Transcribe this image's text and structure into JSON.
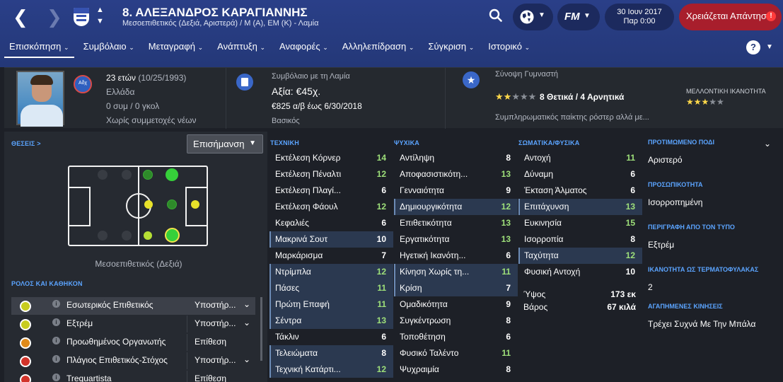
{
  "header": {
    "title": "8. ΑΛΕΞΑΝΔΡΟΣ ΚΑΡΑΓΙΑΝΝΗΣ",
    "subtitle": "Μεσοεπιθετικός (Δεξιά, Αριστερά) / Μ (Α), ΕΜ (Κ) - Λαμία",
    "date": "30 Ιουν 2017",
    "time": "Παρ 0:00",
    "alert": "Χρειάζεται Απάντηση",
    "fm_label": "FM",
    "help": "?",
    "colors": {
      "header": "#2a3f88",
      "alert": "#a81e2c",
      "accent": "#5ba4ff",
      "high_value": "#9ee07a"
    }
  },
  "menu": [
    "Επισκόπηση",
    "Συμβόλαιο",
    "Μεταγραφή",
    "Ανάπτυξη",
    "Αναφορές",
    "Αλληλεπίδραση",
    "Σύγκριση",
    "Ιστορικό"
  ],
  "info": {
    "age": "23 ετών",
    "dob": "(10/25/1993)",
    "nation": "Ελλάδα",
    "caps": "0 συμ / 0 γκολ",
    "youth": "Χωρίς συμμετοχές νέων",
    "club_badge": "Αδχ",
    "contract_title": "Συμβόλαιο με τη Λαμία",
    "value": "Αξία: €45χ.",
    "wage": "€825 α/β έως 6/30/2018",
    "status": "Βασικός",
    "coach_title": "Σύνοψη Γυμναστή",
    "coach_summary": "8 Θετικά / 4 Αρνητικά",
    "coach_comment": "Συμπληρωματικός παίκτης ρόστερ αλλά με...",
    "current_stars": 2.5,
    "potential_label": "ΜΕΛΛΟΝΤΙΚΗ ΙΚΑΝΟΤΗΤΑ",
    "potential_stars": 3.5
  },
  "positions": {
    "title": "ΘΕΣΕΙΣ >",
    "dropdown": "Επισήμανση",
    "caption": "Μεσοεπιθετικός (Δεξιά)"
  },
  "roles": {
    "title": "ΡΟΛΟΣ ΚΑΙ ΚΑΘΗΚΟΝ",
    "items": [
      {
        "name": "Εσωτερικός Επιθετικός",
        "duty": "Υποστήρ...",
        "color": "#c8cc1f"
      },
      {
        "name": "Εξτρέμ",
        "duty": "Υποστήρ...",
        "color": "#c8cc1f"
      },
      {
        "name": "Προωθημένος Οργανωτής",
        "duty": "Επίθεση",
        "color": "#e08a1a"
      },
      {
        "name": "Πλάγιος Επιθετικός-Στόχος",
        "duty": "Υποστήρ...",
        "color": "#d2332a"
      },
      {
        "name": "Trequartista",
        "duty": "Επίθεση",
        "color": "#d2332a"
      }
    ]
  },
  "technical": {
    "title": "ΤΕΧΝΙΚΗ",
    "items": [
      {
        "name": "Εκτέλεση Κόρνερ",
        "value": "14"
      },
      {
        "name": "Εκτέλεση Πέναλτι",
        "value": "12"
      },
      {
        "name": "Εκτέλεση Πλαγί...",
        "value": "6"
      },
      {
        "name": "Εκτέλεση Φάουλ",
        "value": "12"
      },
      {
        "name": "Κεφαλιές",
        "value": "6"
      },
      {
        "name": "Μακρινά Σουτ",
        "value": "10"
      },
      {
        "name": "Μαρκάρισμα",
        "value": "7"
      },
      {
        "name": "Ντρίμπλα",
        "value": "12"
      },
      {
        "name": "Πάσες",
        "value": "11"
      },
      {
        "name": "Πρώτη Επαφή",
        "value": "11"
      },
      {
        "name": "Σέντρα",
        "value": "13"
      },
      {
        "name": "Τάκλιν",
        "value": "6"
      },
      {
        "name": "Τελειώματα",
        "value": "8"
      },
      {
        "name": "Τεχνική Κατάρτι...",
        "value": "12"
      }
    ]
  },
  "mental": {
    "title": "ΨΥΧΙΚΑ",
    "items": [
      {
        "name": "Αντίληψη",
        "value": "8"
      },
      {
        "name": "Αποφασιστικότη...",
        "value": "13"
      },
      {
        "name": "Γενναιότητα",
        "value": "9"
      },
      {
        "name": "Δημιουργικότητα",
        "value": "12"
      },
      {
        "name": "Επιθετικότητα",
        "value": "13"
      },
      {
        "name": "Εργατικότητα",
        "value": "13"
      },
      {
        "name": "Ηγετική Ικανότη...",
        "value": "6"
      },
      {
        "name": "Κίνηση Χωρίς τη...",
        "value": "11"
      },
      {
        "name": "Κρίση",
        "value": "7"
      },
      {
        "name": "Ομαδικότητα",
        "value": "9"
      },
      {
        "name": "Συγκέντρωση",
        "value": "8"
      },
      {
        "name": "Τοποθέτηση",
        "value": "6"
      },
      {
        "name": "Φυσικό Ταλέντο",
        "value": "11"
      },
      {
        "name": "Ψυχραιμία",
        "value": "8"
      }
    ]
  },
  "physical": {
    "title": "ΣΩΜΑΤΙΚΑ/ΦΥΣΙΚΑ",
    "items": [
      {
        "name": "Αντοχή",
        "value": "11"
      },
      {
        "name": "Δύναμη",
        "value": "6"
      },
      {
        "name": "Έκταση Άλματος",
        "value": "6"
      },
      {
        "name": "Επιτάχυνση",
        "value": "13"
      },
      {
        "name": "Ευκινησία",
        "value": "15"
      },
      {
        "name": "Ισορροπία",
        "value": "8"
      },
      {
        "name": "Ταχύτητα",
        "value": "12"
      },
      {
        "name": "Φυσική Αντοχή",
        "value": "10"
      }
    ],
    "height_label": "Ύψος",
    "height": "173 εκ",
    "weight_label": "Βάρος",
    "weight": "67 κιλά"
  },
  "side": {
    "foot_label": "ΠΡΟΤΙΜΩΜΕΝΟ ΠΟΔΙ",
    "foot": "Αριστερό",
    "personality_label": "ΠΡΟΣΩΠΙΚΟΤΗΤΑ",
    "personality": "Ισορροπημένη",
    "media_label": "ΠΕΡΙΓΡΑΦΗ ΑΠΟ ΤΟΝ ΤΥΠΟ",
    "media": "Εξτρέμ",
    "gk_label": "ΙΚΑΝΟΤΗΤΑ ΩΣ ΤΕΡΜΑΤΟΦΥΛΑΚΑΣ",
    "gk": "2",
    "moves_label": "ΑΓΑΠΗΜΕΝΕΣ ΚΙΝΗΣΕΙΣ",
    "moves": "Τρέχει Συχνά Με Την Μπάλα"
  }
}
